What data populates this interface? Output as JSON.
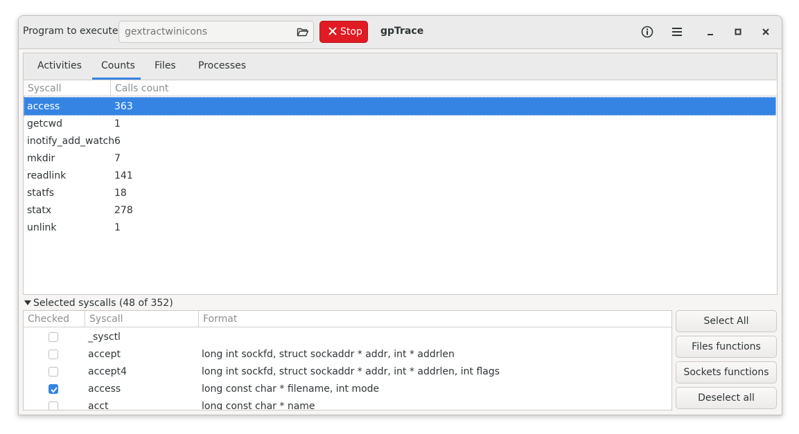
{
  "header": {
    "program_label": "Program to execute:",
    "program_placeholder": "gextractwinicons",
    "stop_label": "Stop",
    "title": "gpTrace"
  },
  "tabs": [
    {
      "label": "Activities"
    },
    {
      "label": "Counts"
    },
    {
      "label": "Files"
    },
    {
      "label": "Processes"
    }
  ],
  "counts_table": {
    "columns": [
      "Syscall",
      "Calls count"
    ],
    "rows": [
      {
        "syscall": "access",
        "count": "363"
      },
      {
        "syscall": "getcwd",
        "count": "1"
      },
      {
        "syscall": "inotify_add_watch",
        "count": "6"
      },
      {
        "syscall": "mkdir",
        "count": "7"
      },
      {
        "syscall": "readlink",
        "count": "141"
      },
      {
        "syscall": "statfs",
        "count": "18"
      },
      {
        "syscall": "statx",
        "count": "278"
      },
      {
        "syscall": "unlink",
        "count": "1"
      }
    ]
  },
  "selected": {
    "expander_label": "Selected syscalls (48 of 352)",
    "columns": [
      "Checked",
      "Syscall",
      "Format"
    ],
    "rows": [
      {
        "checked": false,
        "syscall": "_sysctl",
        "format": ""
      },
      {
        "checked": false,
        "syscall": "accept",
        "format": "long int sockfd, struct sockaddr * addr, int * addrlen"
      },
      {
        "checked": false,
        "syscall": "accept4",
        "format": "long int sockfd, struct sockaddr * addr, int * addrlen, int flags"
      },
      {
        "checked": true,
        "syscall": "access",
        "format": "long const char * filename, int mode"
      },
      {
        "checked": false,
        "syscall": "acct",
        "format": "long const char * name"
      }
    ]
  },
  "buttons": {
    "select_all": "Select All",
    "files_functions": "Files functions",
    "sockets_functions": "Sockets functions",
    "deselect_all": "Deselect all"
  },
  "colors": {
    "accent": "#3584e4",
    "stop": "#e01b24"
  }
}
